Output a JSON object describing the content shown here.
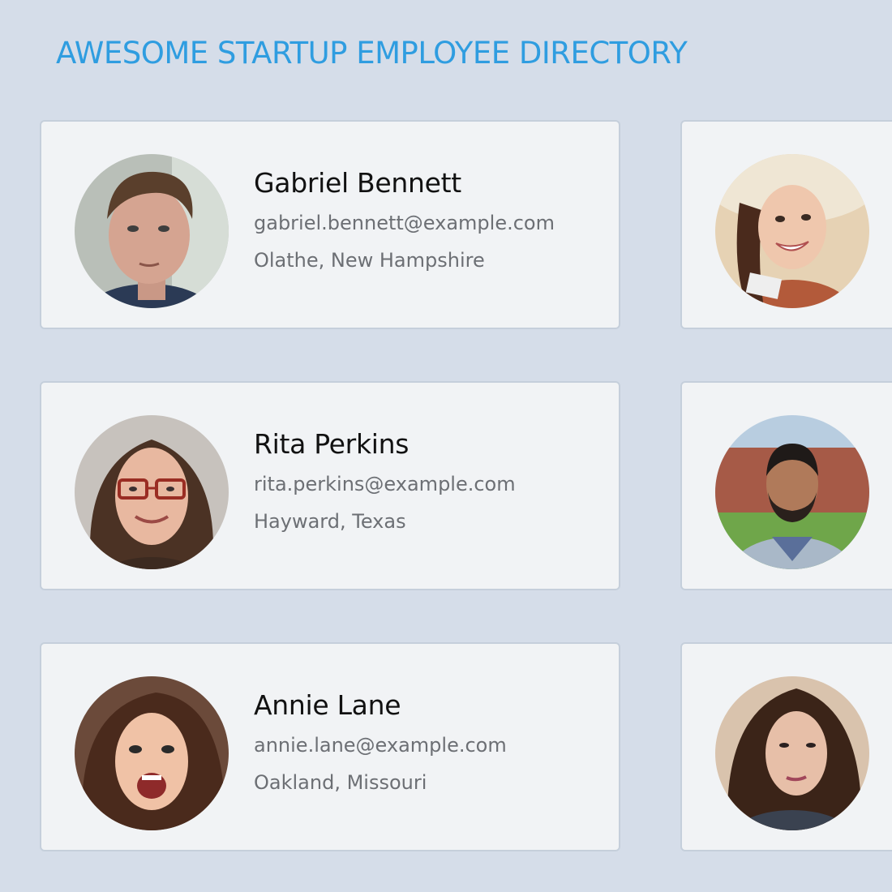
{
  "page": {
    "title": "AWESOME STARTUP EMPLOYEE DIRECTORY"
  },
  "employees": [
    {
      "name": "Gabriel Bennett",
      "email": "gabriel.bennett@example.com",
      "location": "Olathe, New Hampshire",
      "avatar": "man-short-brown-hair-photo"
    },
    {
      "avatar": "woman-sun-hat-smiling-photo"
    },
    {
      "name": "Rita Perkins",
      "email": "rita.perkins@example.com",
      "location": "Hayward, Texas",
      "avatar": "woman-glasses-long-hair-photo"
    },
    {
      "avatar": "man-beard-outdoor-building-photo"
    },
    {
      "name": "Annie Lane",
      "email": "annie.lane@example.com",
      "location": "Oakland, Missouri",
      "avatar": "woman-surprised-brown-hair-photo"
    },
    {
      "avatar": "woman-long-hair-selfie-photo"
    }
  ],
  "colors": {
    "background": "#d5dde9",
    "card": "#f1f3f5",
    "card_border": "#c5cfdb",
    "title": "#2f9de0",
    "name": "#111111",
    "detail": "#6c6f74"
  }
}
